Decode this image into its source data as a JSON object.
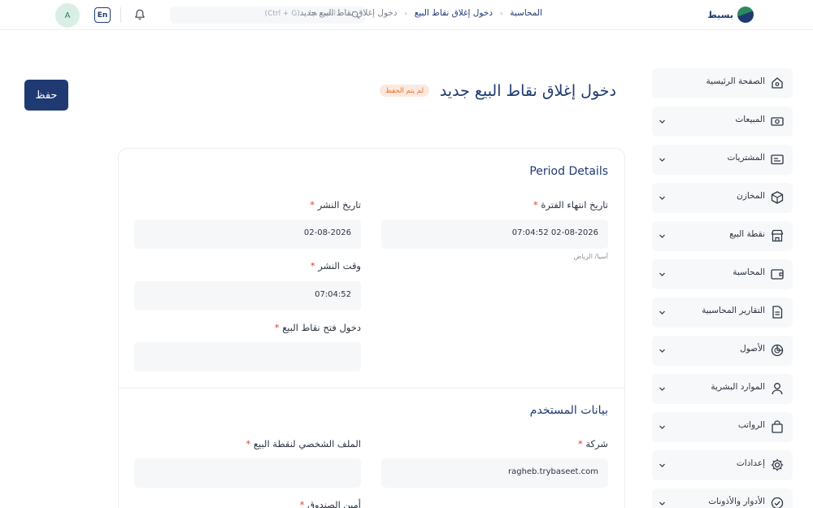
{
  "topbar": {
    "avatar_initial": "A",
    "lang_label": "En",
    "search_placeholder": "ابحث هنا... (Ctrl + G)",
    "brand_name": "بسيط",
    "breadcrumb": [
      "المحاسبة",
      "دخول إغلاق نقاط البيع",
      "دخول إغلاق نقاط البيع جديد"
    ]
  },
  "sidebar": {
    "items": [
      {
        "label": "الصفحة الرئيسية",
        "icon": "home-icon",
        "has_chevron": false
      },
      {
        "label": "المبيعات",
        "icon": "cash-icon",
        "has_chevron": true
      },
      {
        "label": "المشتريات",
        "icon": "receipt-icon",
        "has_chevron": true
      },
      {
        "label": "المخازن",
        "icon": "box-icon",
        "has_chevron": true
      },
      {
        "label": "نقطة البيع",
        "icon": "store-icon",
        "has_chevron": true
      },
      {
        "label": "المحاسبة",
        "icon": "wallet-icon",
        "has_chevron": true
      },
      {
        "label": "التقارير المحاسبية",
        "icon": "document-icon",
        "has_chevron": true
      },
      {
        "label": "الأصول",
        "icon": "pie-chart-icon",
        "has_chevron": true
      },
      {
        "label": "الموارد البشرية",
        "icon": "user-icon",
        "has_chevron": true
      },
      {
        "label": "الرواتب",
        "icon": "bag-icon",
        "has_chevron": true
      },
      {
        "label": "إعدادات",
        "icon": "gear-icon",
        "has_chevron": true
      },
      {
        "label": "الأدوار والأذونات",
        "icon": "check-circle-icon",
        "has_chevron": true
      }
    ]
  },
  "header": {
    "save_label": "حفظ",
    "title": "دخول إغلاق نقاط البيع جديد",
    "status_badge": "لم يتم الحفظ"
  },
  "period_details": {
    "title": "Period Details",
    "period_end_label": "تاريخ انتهاء الفترة",
    "period_end_value": "02-08-2026 07:04:52",
    "period_end_hint": "آسيا/ الرياض",
    "posting_date_label": "تاريخ النشر",
    "posting_date_value": "02-08-2026",
    "posting_time_label": "وقت النشر",
    "posting_time_value": "07:04:52",
    "opening_entry_label": "دخول فتح نقاط البيع",
    "opening_entry_value": ""
  },
  "user_details": {
    "title": "بيانات المستخدم",
    "company_label": "شركة",
    "company_value": "ragheb.trybaseet.com",
    "pos_profile_label": "الملف الشخصي لنقطة البيع",
    "pos_profile_value": "",
    "cashier_label": "أمين الصندوق"
  },
  "colors": {
    "primary": "#1f3a73",
    "badge_bg": "#fde8e0",
    "badge_text": "#e0732b",
    "required": "#e0443a"
  }
}
